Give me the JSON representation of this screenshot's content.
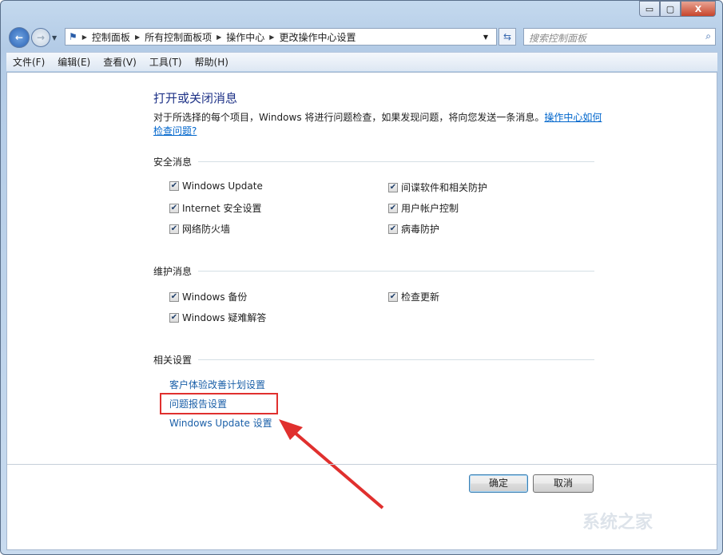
{
  "window": {
    "minimize": "▭",
    "maximize": "▢",
    "close": "X"
  },
  "address": {
    "crumbs": [
      "控制面板",
      "所有控制面板项",
      "操作中心",
      "更改操作中心设置"
    ]
  },
  "search": {
    "placeholder": "搜索控制面板"
  },
  "menu": [
    "文件(F)",
    "编辑(E)",
    "查看(V)",
    "工具(T)",
    "帮助(H)"
  ],
  "main": {
    "title": "打开或关闭消息",
    "description": "对于所选择的每个项目，Windows 将进行问题检查，如果发现问题，将向您发送一条消息。",
    "description_link": "操作中心如何检查问题?",
    "security": {
      "heading": "安全消息",
      "items": [
        {
          "label": "Windows Update",
          "checked": true
        },
        {
          "label": "间谍软件和相关防护",
          "checked": true
        },
        {
          "label": "Internet 安全设置",
          "checked": true
        },
        {
          "label": "用户帐户控制",
          "checked": true
        },
        {
          "label": "网络防火墙",
          "checked": true
        },
        {
          "label": "病毒防护",
          "checked": true
        }
      ]
    },
    "maintenance": {
      "heading": "维护消息",
      "items": [
        {
          "label": "Windows 备份",
          "checked": true
        },
        {
          "label": "检查更新",
          "checked": true
        },
        {
          "label": "Windows 疑难解答",
          "checked": true
        }
      ]
    },
    "related": {
      "heading": "相关设置",
      "links": [
        "客户体验改善计划设置",
        "问题报告设置",
        "Windows Update 设置"
      ]
    }
  },
  "buttons": {
    "ok": "确定",
    "cancel": "取消"
  },
  "watermark": "系统之家",
  "colors": {
    "highlight": "#e0302e",
    "link": "#1a5fa8"
  }
}
